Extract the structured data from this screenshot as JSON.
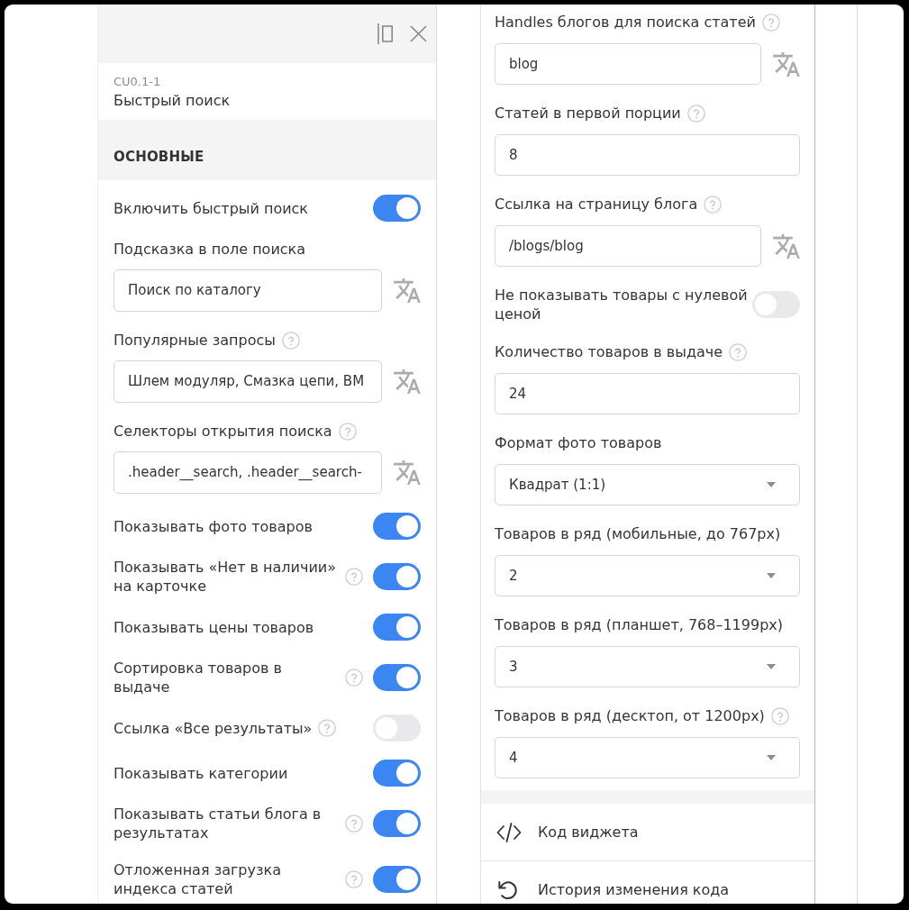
{
  "left_panel": {
    "widget": {
      "code": "CU0.1-1",
      "title": "Быстрый поиск"
    },
    "section": {
      "title": "ОСНОВНЫЕ"
    },
    "settings": [
      {
        "kind": "toggle",
        "label": "Включить быстрый поиск",
        "help": false,
        "on": true
      },
      {
        "kind": "input",
        "label": "Подсказка в поле поиска",
        "help": false,
        "value": "Поиск по каталогу",
        "translatable": true
      },
      {
        "kind": "input",
        "label": "Популярные запросы",
        "help": true,
        "value": "Шлем модуляр, Смазка цепи, BM",
        "translatable": true
      },
      {
        "kind": "input",
        "label": "Селекторы открытия поиска",
        "help": true,
        "value": ".header__search, .header__search-",
        "translatable": true
      },
      {
        "kind": "toggle",
        "label": "Показывать фото товаров",
        "help": false,
        "on": true
      },
      {
        "kind": "toggle",
        "label": "Показывать «Нет в наличии» на карточке",
        "help": true,
        "on": true
      },
      {
        "kind": "toggle",
        "label": "Показывать цены товаров",
        "help": false,
        "on": true
      },
      {
        "kind": "toggle",
        "label": "Сортировка товаров в выдаче",
        "help": true,
        "on": true
      },
      {
        "kind": "toggle",
        "label": "Ссылка «Все результаты»",
        "help": true,
        "on": false
      },
      {
        "kind": "toggle",
        "label": "Показывать категории",
        "help": false,
        "on": true
      },
      {
        "kind": "toggle",
        "label": "Показывать статьи блога в результатах",
        "help": true,
        "on": true
      },
      {
        "kind": "toggle",
        "label": "Отложенная загрузка индекса статей",
        "help": true,
        "on": true
      }
    ]
  },
  "right_panel": {
    "settings": [
      {
        "kind": "input",
        "label": "Handles блогов для поиска статей",
        "help": true,
        "value": "blog",
        "translatable": true
      },
      {
        "kind": "input",
        "label": "Статей в первой порции",
        "help": true,
        "value": "8",
        "translatable": false
      },
      {
        "kind": "input",
        "label": "Ссылка на страницу блога",
        "help": true,
        "value": "/blogs/blog",
        "translatable": true
      },
      {
        "kind": "toggle",
        "label": "Не показывать товары с нулевой ценой",
        "help": false,
        "on": false
      },
      {
        "kind": "input",
        "label": "Количество товаров в выдаче",
        "help": true,
        "value": "24",
        "translatable": false
      },
      {
        "kind": "select",
        "label": "Формат фото товаров",
        "help": false,
        "value": "Квадрат (1:1)"
      },
      {
        "kind": "select",
        "label": "Товаров в ряд (мобильные, до 767px)",
        "help": false,
        "value": "2"
      },
      {
        "kind": "select",
        "label": "Товаров в ряд (планшет, 768–1199px)",
        "help": false,
        "value": "3"
      },
      {
        "kind": "select",
        "label": "Товаров в ряд (десктоп, от 1200px)",
        "help": true,
        "value": "4"
      }
    ],
    "links": [
      {
        "kind": "code",
        "label": "Код виджета"
      },
      {
        "kind": "history",
        "label": "История изменения кода"
      }
    ]
  }
}
